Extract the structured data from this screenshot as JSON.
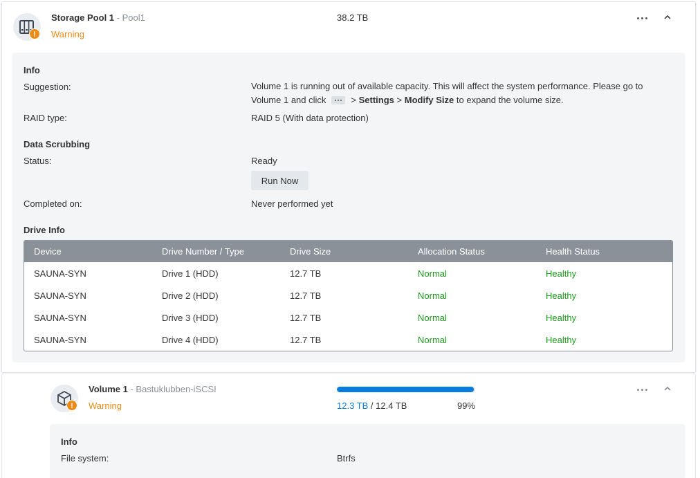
{
  "storage_pool": {
    "title": "Storage Pool 1",
    "subtitle": "- Pool1",
    "status": "Warning",
    "capacity": "38.2 TB",
    "info": {
      "section_title": "Info",
      "suggestion_label": "Suggestion:",
      "suggestion_part1": "Volume 1 is running out of available capacity. This will affect the system performance. Please go to",
      "suggestion_part2a": "Volume 1 and click",
      "suggestion_sep1": ">",
      "suggestion_settings": "Settings",
      "suggestion_sep2": ">",
      "suggestion_modify": "Modify Size",
      "suggestion_part2b": "to expand the volume size.",
      "raid_label": "RAID type:",
      "raid_value": "RAID 5 (With data protection)"
    },
    "scrubbing": {
      "section_title": "Data Scrubbing",
      "status_label": "Status:",
      "status_value": "Ready",
      "run_button": "Run Now",
      "completed_label": "Completed on:",
      "completed_value": "Never performed yet"
    },
    "drive_info": {
      "section_title": "Drive Info",
      "columns": [
        "Device",
        "Drive Number / Type",
        "Drive Size",
        "Allocation Status",
        "Health Status"
      ],
      "rows": [
        [
          "SAUNA-SYN",
          "Drive 1 (HDD)",
          "12.7 TB",
          "Normal",
          "Healthy"
        ],
        [
          "SAUNA-SYN",
          "Drive 2 (HDD)",
          "12.7 TB",
          "Normal",
          "Healthy"
        ],
        [
          "SAUNA-SYN",
          "Drive 3 (HDD)",
          "12.7 TB",
          "Normal",
          "Healthy"
        ],
        [
          "SAUNA-SYN",
          "Drive 4 (HDD)",
          "12.7 TB",
          "Normal",
          "Healthy"
        ]
      ]
    },
    "icon": "storage-pool-icon"
  },
  "volume": {
    "title": "Volume 1",
    "subtitle": "- Bastuklubben-iSCSI",
    "status": "Warning",
    "used": "12.3 TB",
    "sep": "/",
    "total": "12.4 TB",
    "percent": "99%",
    "usage_fraction": 0.99,
    "info": {
      "section_title": "Info",
      "fs_label": "File system:",
      "fs_value": "Btrfs"
    },
    "icon": "volume-cube-icon"
  },
  "colors": {
    "warning": "#ef8a16",
    "healthy": "#1a9a1a",
    "accent": "#0a7cde",
    "table_header": "#8a9199"
  }
}
